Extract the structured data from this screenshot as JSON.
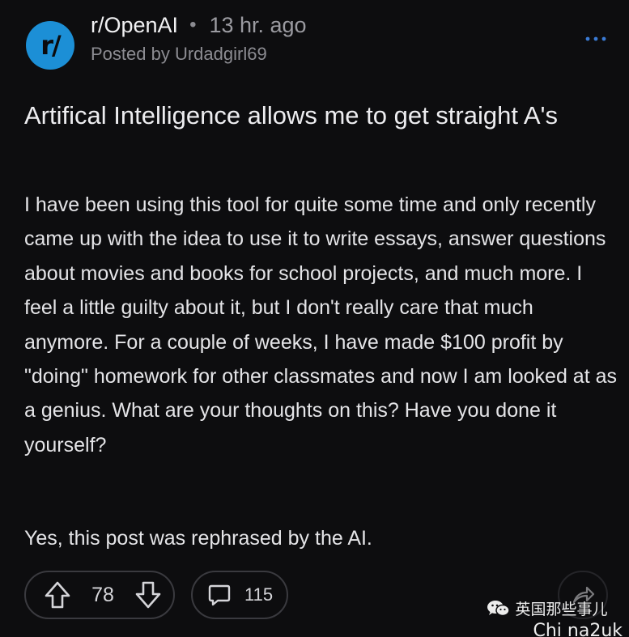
{
  "post": {
    "avatar_text": "r/",
    "subreddit": "r/OpenAI",
    "separator": "•",
    "time_ago": "13 hr. ago",
    "posted_by": "Posted by Urdadgirl69",
    "more_icon": "ellipsis-icon",
    "title": "Artifical Intelligence allows me to get straight A's",
    "body": "I have been using this tool for quite some time and only recently came up with the idea to use it to write essays, answer questions about movies and books for school projects, and much more. I feel a little guilty about it, but I don't really care that much anymore. For a couple of weeks, I have made $100 profit by \"doing\" homework for other classmates and now I am looked at as a genius. What are your thoughts on this? Have you done it yourself?",
    "postscript": "Yes, this post was rephrased by the AI."
  },
  "actions": {
    "upvote_icon": "arrow-up-icon",
    "vote_count": "78",
    "downvote_icon": "arrow-down-icon",
    "comment_icon": "comment-bubble-icon",
    "comment_count": "115",
    "share_icon": "share-arrow-icon"
  },
  "watermark": {
    "line1": "英国那些事儿",
    "line2": "Chi na2uk"
  },
  "colors": {
    "background": "#0d0d0f",
    "avatar": "#1c8fd6",
    "accent": "#3a7bd5",
    "border": "#3a3a3f"
  }
}
